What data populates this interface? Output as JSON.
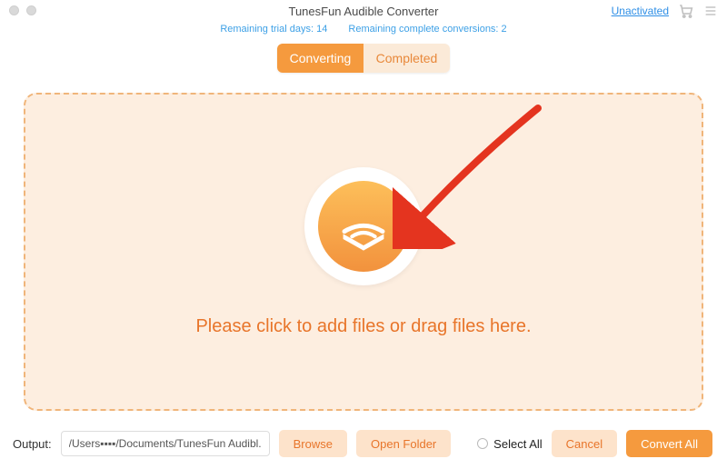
{
  "header": {
    "title": "TunesFun Audible Converter",
    "activation_link": "Unactivated",
    "trial_days_label": "Remaining trial days: 14",
    "conversions_label": "Remaining complete conversions: 2"
  },
  "tabs": {
    "converting": "Converting",
    "completed": "Completed",
    "active": "converting"
  },
  "dropzone": {
    "prompt": "Please click to add files or drag files here."
  },
  "footer": {
    "output_label": "Output:",
    "output_path": "/Users▪▪▪▪/Documents/TunesFun Audibl...",
    "browse": "Browse",
    "open_folder": "Open Folder",
    "select_all": "Select All",
    "cancel": "Cancel",
    "convert_all": "Convert All"
  },
  "colors": {
    "accent": "#f59a3e",
    "accent_light": "#fde3cb",
    "drop_bg": "#fdeee0",
    "link": "#2f8fe6"
  }
}
